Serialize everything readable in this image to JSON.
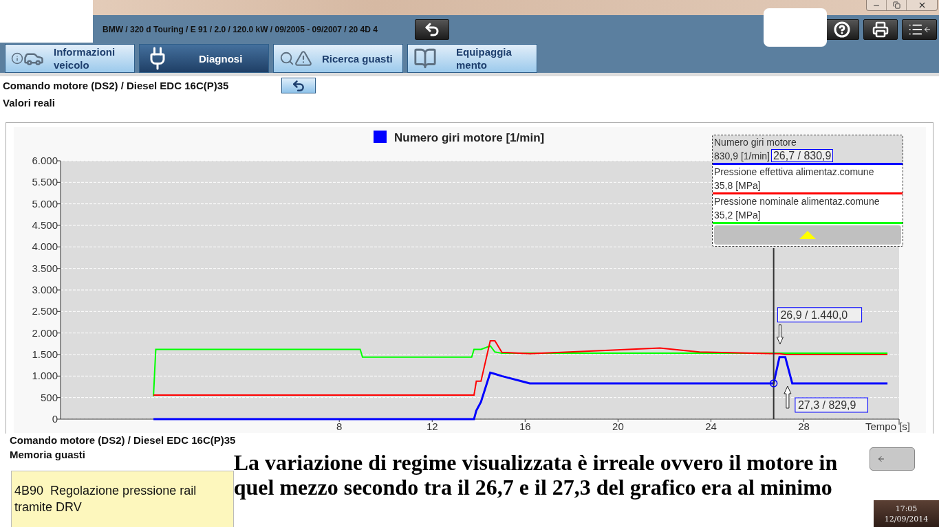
{
  "header": {
    "vehicle": "BMW / 320 d Touring / E 91 / 2.0 / 120.0 kW / 09/2005 - 09/2007 / 20 4D 4"
  },
  "tabs": [
    {
      "label": "Informazioni\nveicolo",
      "kind": "vehicle",
      "selected": false
    },
    {
      "label": "Diagnosi",
      "kind": "diagnosis",
      "selected": true
    },
    {
      "label": "Ricerca guasti",
      "kind": "troubleshoot",
      "selected": false
    },
    {
      "label": "Equipaggia\nmento",
      "kind": "equipment",
      "selected": false
    }
  ],
  "breadcrumb": "Comando motore (DS2) / Diesel EDC 16C(P)35",
  "view_title": "Valori reali",
  "chart": {
    "chart_data": {
      "type": "line",
      "title": "Numero giri motore [1/min]",
      "xlabel": "Tempo [s]",
      "grid": true,
      "x": [
        0,
        0.1,
        8.9,
        9.0,
        13.7,
        13.8,
        13.9,
        14.1,
        14.5,
        14.7,
        15,
        16.2,
        21.8,
        23.5,
        26.7,
        26.95,
        27.2,
        27.5,
        31.6
      ],
      "series": [
        {
          "name": "Numero giri motore",
          "color": "#0000ff",
          "values": [
            0,
            0,
            0,
            0,
            0,
            0,
            200,
            400,
            1080,
            1050,
            1000,
            830,
            830,
            830,
            830,
            1440,
            1440,
            830,
            830
          ]
        },
        {
          "name": "Pressione effettiva alimentaz.comune",
          "color": "#ff0000",
          "values": [
            560,
            560,
            560,
            560,
            560,
            560,
            880,
            880,
            1820,
            1820,
            1550,
            1520,
            1650,
            1560,
            1520,
            1520,
            1500,
            1500,
            1500
          ]
        },
        {
          "name": "Pressione nominale alimentaz.comune",
          "color": "#00ff00",
          "values": [
            530,
            1620,
            1620,
            1440,
            1440,
            1620,
            1620,
            1620,
            1700,
            1560,
            1530,
            1530,
            1530,
            1530,
            1530,
            1530,
            1530,
            1530,
            1530
          ]
        }
      ],
      "ref_lines": [
        {
          "axis": "x",
          "value": 26.7
        }
      ],
      "xlim": [
        -4,
        32.1
      ],
      "ylim": [
        0,
        6000
      ],
      "xticks": [
        8,
        12,
        16,
        20,
        24,
        28
      ],
      "yticks": [
        {
          "value": 0,
          "label": "0"
        },
        {
          "value": 500,
          "label": "500"
        },
        {
          "value": 1000,
          "label": "1.000"
        },
        {
          "value": 1500,
          "label": "1.500"
        },
        {
          "value": 2000,
          "label": "2.000"
        },
        {
          "value": 2500,
          "label": "2.500"
        },
        {
          "value": 3000,
          "label": "3.000"
        },
        {
          "value": 3500,
          "label": "3.500"
        },
        {
          "value": 4000,
          "label": "4.000"
        },
        {
          "value": 4500,
          "label": "4.500"
        },
        {
          "value": 5000,
          "label": "5.000"
        },
        {
          "value": 5500,
          "label": "5.500"
        },
        {
          "value": 6000,
          "label": "6.000"
        }
      ]
    },
    "cursor_values": [
      "830,9 [1/min]",
      "35,8 [MPa]",
      "35,2 [MPa]"
    ],
    "callouts": [
      {
        "kind": "cursor",
        "label": "26,7 / 830,9"
      },
      {
        "kind": "peak",
        "label": "26,9 / 1.440,0"
      },
      {
        "kind": "trough",
        "label": "27,3 / 829,9"
      }
    ]
  },
  "fault_section": {
    "module": "Comando motore (DS2) / Diesel EDC 16C(P)35",
    "title": "Memoria guasti",
    "faults": [
      {
        "code": "4B90",
        "description": "Regolazione pressione rail tramite DRV"
      }
    ]
  },
  "note": "La variazione di regime visualizzata è irreale ovvero il motore in quel mezzo secondo tra il 26,7 e il 27,3 del grafico era al minimo",
  "taskbar": {
    "time": "17:05",
    "date": "12/09/2014"
  }
}
